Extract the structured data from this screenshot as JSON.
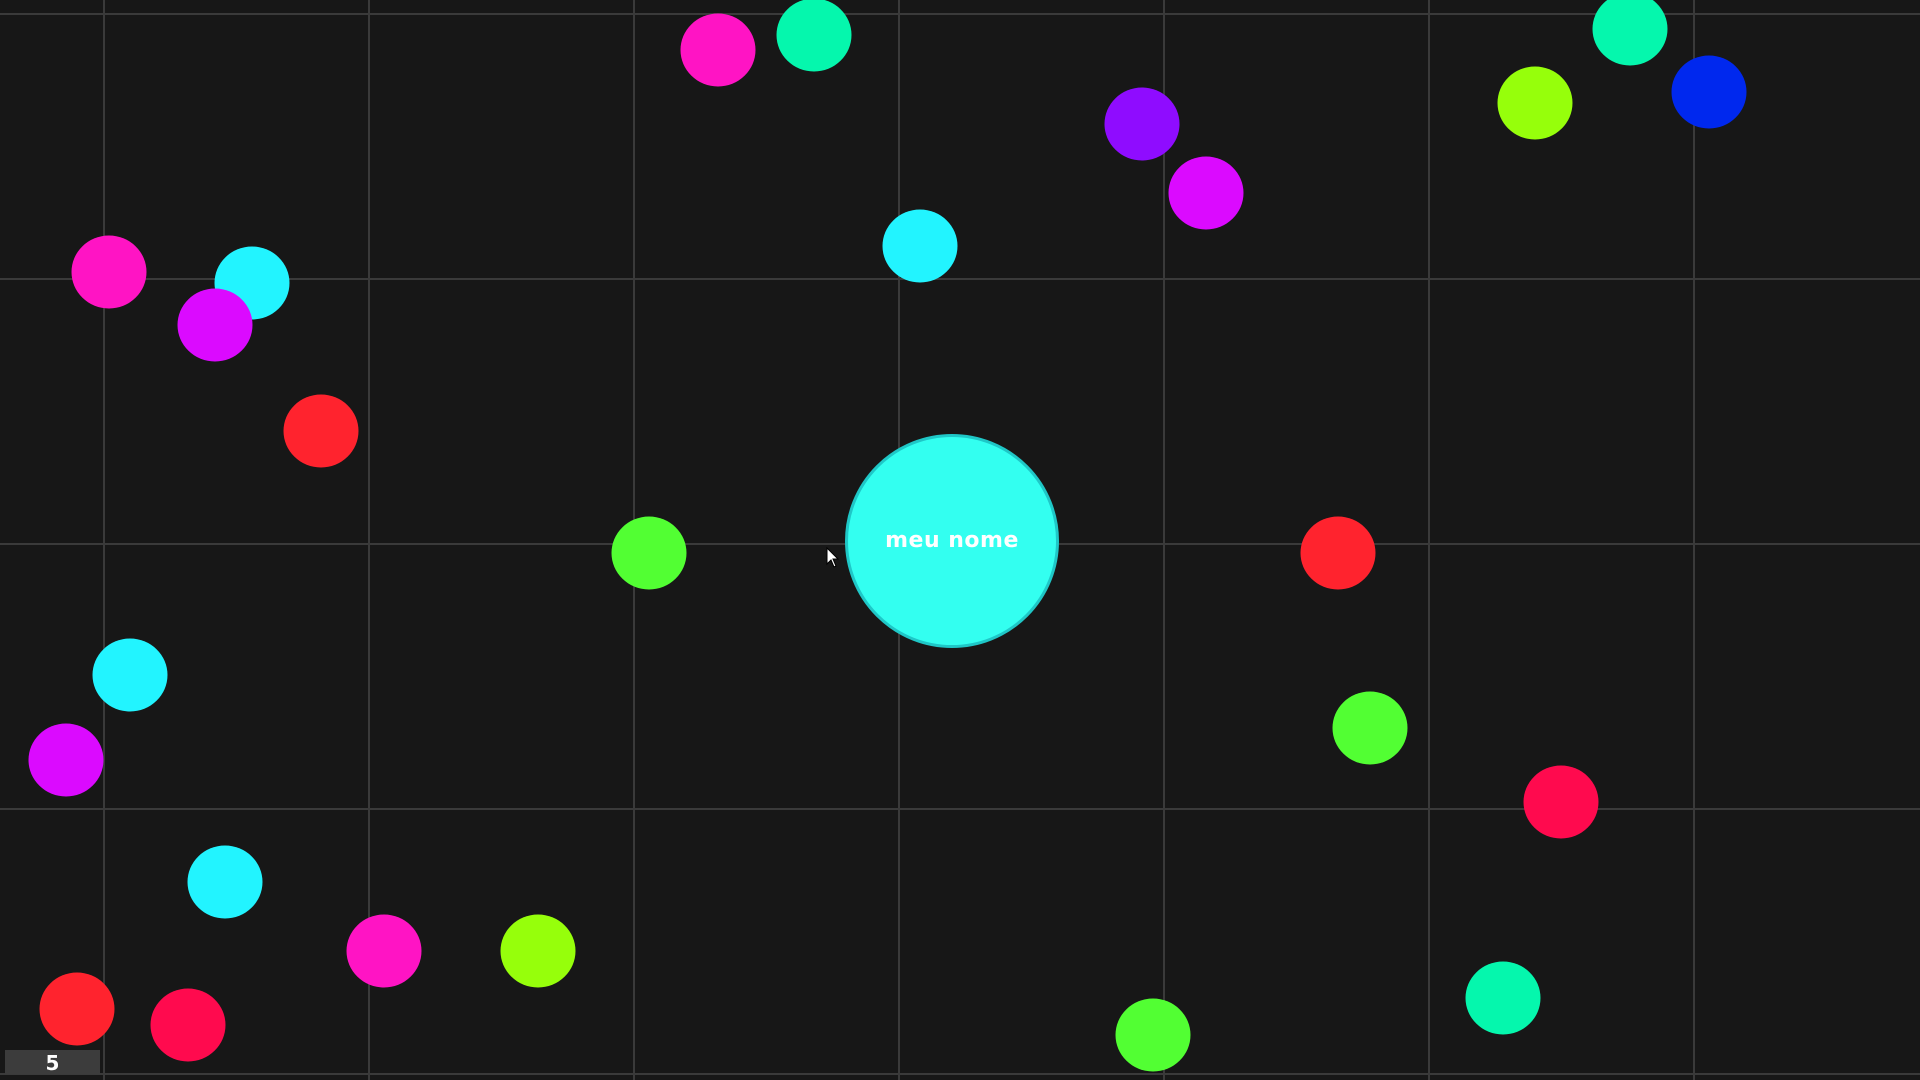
{
  "player": {
    "name": "meu nome",
    "color": "#33fff0"
  },
  "score": "5",
  "grid_color": "#3a3a3a",
  "background_color": "#171717",
  "food_colors": [
    "#ff14c4",
    "#05f7ad",
    "#8f0cff",
    "#db0aff",
    "#22f4ff",
    "#ff232e",
    "#52ff33",
    "#96ff0b",
    "#0028ee",
    "#ff0a4e"
  ]
}
